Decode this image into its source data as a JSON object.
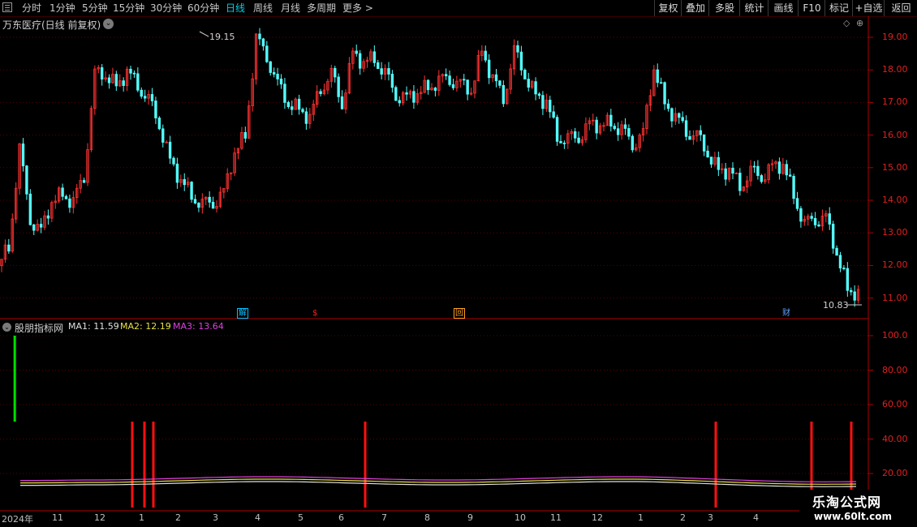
{
  "toolbar": {
    "periods": [
      "分时",
      "1分钟",
      "5分钟",
      "15分钟",
      "30分钟",
      "60分钟",
      "日线",
      "周线",
      "月线",
      "多周期",
      "更多 >"
    ],
    "active_period": "日线",
    "right_buttons": [
      "复权",
      "叠加",
      "多股",
      "统计",
      "画线",
      "F10",
      "标记",
      "+自选",
      "返回"
    ]
  },
  "stock": {
    "title": "万东医疗(日线 前复权)"
  },
  "price_axis": {
    "labels": [
      "19.00",
      "18.00",
      "17.00",
      "16.00",
      "15.00",
      "14.00",
      "13.00",
      "12.00",
      "11.00"
    ],
    "max_label": "19.15",
    "min_label": "10.83"
  },
  "events": [
    {
      "label": "解",
      "color": "#00c0ff"
    },
    {
      "label": "$",
      "color": "#ff2020"
    },
    {
      "label": "回",
      "color": "#ffa020"
    },
    {
      "label": "财",
      "color": "#60a0ff"
    }
  ],
  "indicator": {
    "name": "股朋指标网",
    "ma1": "MA1: 11.59",
    "ma2": "MA2: 12.19",
    "ma3": "MA3: 13.64",
    "axis_labels": [
      "100.0",
      "80.00",
      "60.00",
      "40.00",
      "20.00"
    ]
  },
  "x_axis": {
    "labels": [
      "2024年",
      "11",
      "12",
      "1",
      "2",
      "3",
      "4",
      "5",
      "6",
      "7",
      "8",
      "9",
      "10",
      "11",
      "12",
      "1",
      "2",
      "3",
      "4"
    ]
  },
  "watermark": {
    "line1": "乐淘公式网",
    "line2": "www.60lt.com"
  },
  "colors": {
    "up": "#ff3232",
    "down": "#54fcfc",
    "axis": "#b00000",
    "grid": "#5a0000",
    "active": "#00cfe8"
  },
  "chart_data": {
    "type": "candlestick",
    "closes": [
      12.0,
      12.6,
      15.5,
      13.5,
      13.0,
      14.0,
      14.2,
      13.9,
      14.8,
      17.8,
      17.9,
      17.5,
      17.9,
      17.6,
      17.0,
      16.4,
      15.2,
      14.6,
      14.2,
      13.8,
      14.0,
      14.2,
      15.5,
      16.0,
      18.9,
      18.5,
      17.5,
      17.0,
      16.8,
      16.5,
      17.5,
      17.8,
      17.0,
      18.5,
      18.2,
      18.4,
      17.8,
      17.3,
      17.1,
      17.3,
      17.5,
      17.6,
      17.8,
      17.5,
      17.4,
      18.6,
      17.7,
      17.2,
      18.5,
      17.9,
      17.2,
      17.0,
      16.0,
      15.8,
      16.0,
      16.3,
      16.3,
      16.4,
      16.1,
      15.8,
      16.0,
      18.1,
      17.0,
      16.5,
      16.2,
      15.9,
      15.5,
      14.9,
      14.9,
      14.5,
      14.8,
      14.8,
      15.0,
      15.1,
      14.2,
      13.2,
      13.5,
      13.4,
      12.4,
      11.3,
      11.1
    ],
    "indicator_spikes": [
      0.163,
      0.178,
      0.189,
      0.45,
      0.882,
      1.0,
      1.049
    ],
    "green_spike": 0.017
  }
}
